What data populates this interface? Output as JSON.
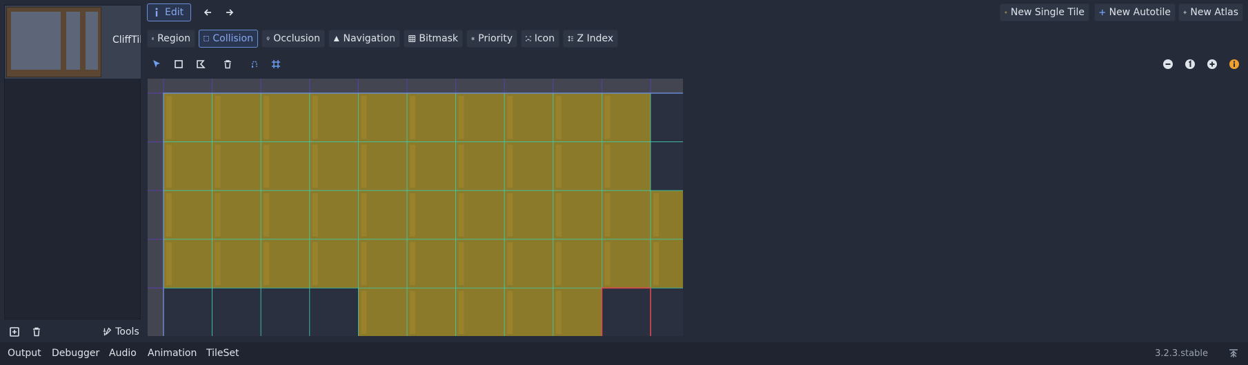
{
  "tileset_list": {
    "item_label": "CliffTil"
  },
  "left_bottom": {
    "tools_label": "Tools"
  },
  "toolbar": {
    "edit_label": "Edit",
    "new_single_tile_label": "New Single Tile",
    "new_autotile_label": "New Autotile",
    "new_atlas_label": "New Atlas"
  },
  "modes": [
    {
      "label": "Region"
    },
    {
      "label": "Collision"
    },
    {
      "label": "Occlusion"
    },
    {
      "label": "Navigation"
    },
    {
      "label": "Bitmask"
    },
    {
      "label": "Priority"
    },
    {
      "label": "Icon"
    },
    {
      "label": "Z Index"
    }
  ],
  "active_mode": "Collision",
  "bottom_tabs": [
    {
      "label": "Output"
    },
    {
      "label": "Debugger"
    },
    {
      "label": "Audio"
    },
    {
      "label": "Animation"
    },
    {
      "label": "TileSet"
    }
  ],
  "active_bottom_tab": "TileSet",
  "version": "3.2.3.stable",
  "colors": {
    "accent": "#6e9ef0",
    "collision_fill": "#8a7a2a",
    "grid_line": "#3fc9a8",
    "region_outline": "#6a8fd6",
    "selected_tile": "#e0494f",
    "empty_tile": "#2a3040"
  },
  "grid": {
    "columns": 11,
    "rows": 5,
    "empty_cells": [
      [
        0,
        10
      ],
      [
        1,
        10
      ],
      [
        4,
        0
      ],
      [
        4,
        1
      ],
      [
        4,
        2
      ],
      [
        4,
        3
      ],
      [
        4,
        10
      ]
    ],
    "selected_cell": [
      4,
      9
    ]
  }
}
